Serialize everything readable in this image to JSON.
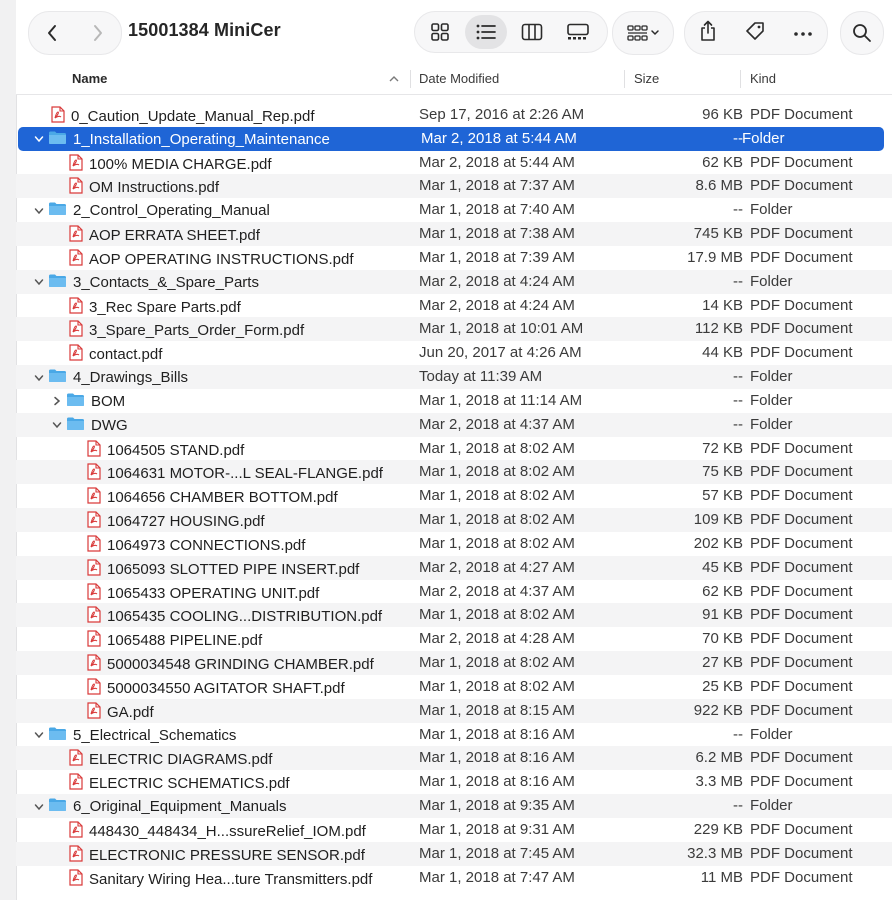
{
  "window": {
    "title": "15001384 MiniCer"
  },
  "toolbar": {
    "back_icon": "chevron-left-icon",
    "forward_icon": "chevron-right-icon",
    "views": [
      {
        "name": "icon-view",
        "icon": "grid-icon",
        "active": false
      },
      {
        "name": "list-view",
        "icon": "list-icon",
        "active": true
      },
      {
        "name": "column-view",
        "icon": "columns-icon",
        "active": false
      },
      {
        "name": "gallery-view",
        "icon": "gallery-icon",
        "active": false
      }
    ],
    "group_icon": "group-by-icon",
    "actions": [
      "share-icon",
      "tag-icon",
      "more-icon"
    ],
    "search_icon": "search-icon"
  },
  "columns": {
    "name": "Name",
    "date": "Date Modified",
    "size": "Size",
    "kind": "Kind",
    "sort_icon": "chevron-up-icon"
  },
  "colors": {
    "selection": "#1f65d6",
    "folder": "#4aa8e6",
    "pdf": "#d93a3a"
  },
  "rows": [
    {
      "name": "0_Caution_Update_Manual_Rep.pdf",
      "date": "Sep 17, 2016 at 2:26 AM",
      "size": "96 KB",
      "kind": "PDF Document",
      "type": "pdf",
      "level": 0
    },
    {
      "name": "1_Installation_Operating_Maintenance",
      "date": "Mar 2, 2018 at 5:44 AM",
      "size": "--",
      "kind": "Folder",
      "type": "folder",
      "level": 0,
      "expanded": true,
      "selected": true
    },
    {
      "name": "100% MEDIA CHARGE.pdf",
      "date": "Mar 2, 2018 at 5:44 AM",
      "size": "62 KB",
      "kind": "PDF Document",
      "type": "pdf",
      "level": 1
    },
    {
      "name": "OM Instructions.pdf",
      "date": "Mar 1, 2018 at 7:37 AM",
      "size": "8.6 MB",
      "kind": "PDF Document",
      "type": "pdf",
      "level": 1
    },
    {
      "name": "2_Control_Operating_Manual",
      "date": "Mar 1, 2018 at 7:40 AM",
      "size": "--",
      "kind": "Folder",
      "type": "folder",
      "level": 0,
      "expanded": true
    },
    {
      "name": "AOP ERRATA SHEET.pdf",
      "date": "Mar 1, 2018 at 7:38 AM",
      "size": "745 KB",
      "kind": "PDF Document",
      "type": "pdf",
      "level": 1
    },
    {
      "name": "AOP OPERATING INSTRUCTIONS.pdf",
      "date": "Mar 1, 2018 at 7:39 AM",
      "size": "17.9 MB",
      "kind": "PDF Document",
      "type": "pdf",
      "level": 1
    },
    {
      "name": "3_Contacts_&_Spare_Parts",
      "date": "Mar 2, 2018 at 4:24 AM",
      "size": "--",
      "kind": "Folder",
      "type": "folder",
      "level": 0,
      "expanded": true
    },
    {
      "name": "3_Rec Spare Parts.pdf",
      "date": "Mar 2, 2018 at 4:24 AM",
      "size": "14 KB",
      "kind": "PDF Document",
      "type": "pdf",
      "level": 1
    },
    {
      "name": "3_Spare_Parts_Order_Form.pdf",
      "date": "Mar 1, 2018 at 10:01 AM",
      "size": "112 KB",
      "kind": "PDF Document",
      "type": "pdf",
      "level": 1
    },
    {
      "name": "contact.pdf",
      "date": "Jun 20, 2017 at 4:26 AM",
      "size": "44 KB",
      "kind": "PDF Document",
      "type": "pdf",
      "level": 1
    },
    {
      "name": "4_Drawings_Bills",
      "date": "Today at 11:39 AM",
      "size": "--",
      "kind": "Folder",
      "type": "folder",
      "level": 0,
      "expanded": true
    },
    {
      "name": "BOM",
      "date": "Mar 1, 2018 at 11:14 AM",
      "size": "--",
      "kind": "Folder",
      "type": "folder",
      "level": 1,
      "expanded": false
    },
    {
      "name": "DWG",
      "date": "Mar 2, 2018 at 4:37 AM",
      "size": "--",
      "kind": "Folder",
      "type": "folder",
      "level": 1,
      "expanded": true
    },
    {
      "name": "1064505 STAND.pdf",
      "date": "Mar 1, 2018 at 8:02 AM",
      "size": "72 KB",
      "kind": "PDF Document",
      "type": "pdf",
      "level": 2
    },
    {
      "name": "1064631 MOTOR-...L SEAL-FLANGE.pdf",
      "date": "Mar 1, 2018 at 8:02 AM",
      "size": "75 KB",
      "kind": "PDF Document",
      "type": "pdf",
      "level": 2
    },
    {
      "name": "1064656 CHAMBER BOTTOM.pdf",
      "date": "Mar 1, 2018 at 8:02 AM",
      "size": "57 KB",
      "kind": "PDF Document",
      "type": "pdf",
      "level": 2
    },
    {
      "name": "1064727 HOUSING.pdf",
      "date": "Mar 1, 2018 at 8:02 AM",
      "size": "109 KB",
      "kind": "PDF Document",
      "type": "pdf",
      "level": 2
    },
    {
      "name": "1064973 CONNECTIONS.pdf",
      "date": "Mar 1, 2018 at 8:02 AM",
      "size": "202 KB",
      "kind": "PDF Document",
      "type": "pdf",
      "level": 2
    },
    {
      "name": "1065093 SLOTTED PIPE INSERT.pdf",
      "date": "Mar 2, 2018 at 4:27 AM",
      "size": "45 KB",
      "kind": "PDF Document",
      "type": "pdf",
      "level": 2
    },
    {
      "name": "1065433 OPERATING UNIT.pdf",
      "date": "Mar 2, 2018 at 4:37 AM",
      "size": "62 KB",
      "kind": "PDF Document",
      "type": "pdf",
      "level": 2
    },
    {
      "name": "1065435 COOLING...DISTRIBUTION.pdf",
      "date": "Mar 1, 2018 at 8:02 AM",
      "size": "91 KB",
      "kind": "PDF Document",
      "type": "pdf",
      "level": 2
    },
    {
      "name": "1065488 PIPELINE.pdf",
      "date": "Mar 2, 2018 at 4:28 AM",
      "size": "70 KB",
      "kind": "PDF Document",
      "type": "pdf",
      "level": 2
    },
    {
      "name": "5000034548 GRINDING CHAMBER.pdf",
      "date": "Mar 1, 2018 at 8:02 AM",
      "size": "27 KB",
      "kind": "PDF Document",
      "type": "pdf",
      "level": 2
    },
    {
      "name": "5000034550 AGITATOR SHAFT.pdf",
      "date": "Mar 1, 2018 at 8:02 AM",
      "size": "25 KB",
      "kind": "PDF Document",
      "type": "pdf",
      "level": 2
    },
    {
      "name": "GA.pdf",
      "date": "Mar 1, 2018 at 8:15 AM",
      "size": "922 KB",
      "kind": "PDF Document",
      "type": "pdf",
      "level": 2
    },
    {
      "name": "5_Electrical_Schematics",
      "date": "Mar 1, 2018 at 8:16 AM",
      "size": "--",
      "kind": "Folder",
      "type": "folder",
      "level": 0,
      "expanded": true
    },
    {
      "name": "ELECTRIC DIAGRAMS.pdf",
      "date": "Mar 1, 2018 at 8:16 AM",
      "size": "6.2 MB",
      "kind": "PDF Document",
      "type": "pdf",
      "level": 1
    },
    {
      "name": "ELECTRIC SCHEMATICS.pdf",
      "date": "Mar 1, 2018 at 8:16 AM",
      "size": "3.3 MB",
      "kind": "PDF Document",
      "type": "pdf",
      "level": 1
    },
    {
      "name": "6_Original_Equipment_Manuals",
      "date": "Mar 1, 2018 at 9:35 AM",
      "size": "--",
      "kind": "Folder",
      "type": "folder",
      "level": 0,
      "expanded": true
    },
    {
      "name": "448430_448434_H...ssureRelief_IOM.pdf",
      "date": "Mar 1, 2018 at 9:31 AM",
      "size": "229 KB",
      "kind": "PDF Document",
      "type": "pdf",
      "level": 1
    },
    {
      "name": "ELECTRONIC PRESSURE SENSOR.pdf",
      "date": "Mar 1, 2018 at 7:45 AM",
      "size": "32.3 MB",
      "kind": "PDF Document",
      "type": "pdf",
      "level": 1
    },
    {
      "name": "Sanitary Wiring Hea...ture Transmitters.pdf",
      "date": "Mar 1, 2018 at 7:47 AM",
      "size": "11 MB",
      "kind": "PDF Document",
      "type": "pdf",
      "level": 1
    }
  ]
}
